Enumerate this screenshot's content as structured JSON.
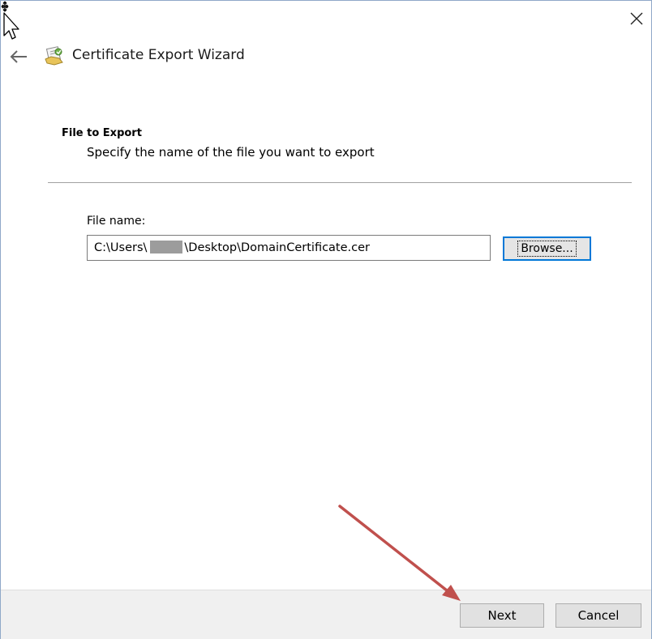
{
  "window": {
    "title": "Certificate Export Wizard"
  },
  "page": {
    "heading": "File to Export",
    "subheading": "Specify the name of the file you want to export"
  },
  "file_field": {
    "label": "File name:",
    "value_prefix": "C:\\Users\\",
    "value_suffix": "\\Desktop\\DomainCertificate.cer"
  },
  "buttons": {
    "browse": "Browse...",
    "next": "Next",
    "cancel": "Cancel"
  },
  "icons": {
    "close": "close-icon",
    "back": "back-arrow-icon",
    "wizard": "certificate-icon",
    "cursor": "mouse-cursor-icon"
  },
  "colors": {
    "accent": "#0078d7",
    "annotation": "#c0504d",
    "footer": "#f0f0f0"
  }
}
